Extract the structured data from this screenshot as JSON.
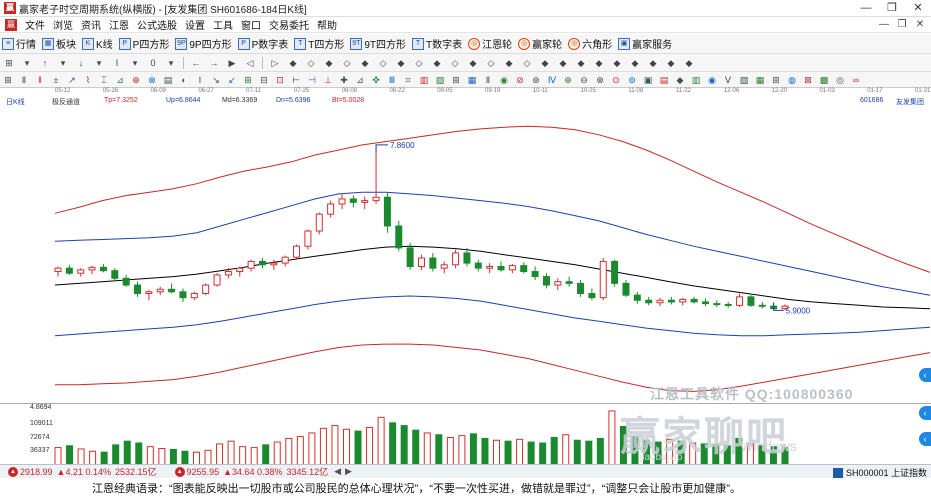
{
  "window": {
    "title": "赢家老子时空周期系统(纵横版) - [友发集团  SH601686-184日K线]",
    "app_icon": "赢",
    "controls": [
      "—",
      "❐",
      "✕"
    ]
  },
  "menu": {
    "icon": "赢",
    "items": [
      "文件",
      "浏览",
      "资讯",
      "江恩",
      "公式选股",
      "设置",
      "工具",
      "窗口",
      "交易委托",
      "帮助"
    ],
    "mdi_controls": [
      "—",
      "❐",
      "✕"
    ]
  },
  "toolbar1": {
    "items": [
      {
        "icon": "≡",
        "label": "行情"
      },
      {
        "icon": "▦",
        "label": "板块"
      },
      {
        "icon": "K",
        "label": "K线"
      },
      {
        "icon": "P",
        "label": "P四方形"
      },
      {
        "icon": "9P",
        "label": "9P四方形"
      },
      {
        "icon": "P",
        "label": "P数字表"
      },
      {
        "icon": "T",
        "label": "T四方形"
      },
      {
        "icon": "9T",
        "label": "9T四方形"
      },
      {
        "icon": "T",
        "label": "T数字表"
      },
      {
        "icon": "◎",
        "label": "江恩轮",
        "round": true
      },
      {
        "icon": "◎",
        "label": "赢家轮",
        "round": true
      },
      {
        "icon": "◎",
        "label": "六角形",
        "round": true
      },
      {
        "icon": "▣",
        "label": "赢家服务"
      }
    ]
  },
  "toolbar2": {
    "items": [
      "⊞",
      "▾",
      "↑",
      "▾",
      "↓",
      "▾",
      "Ι",
      "▾",
      "0",
      "▾",
      "←",
      "→",
      "▶",
      "◁",
      "▷",
      "◆",
      "◇",
      "◆",
      "◇",
      "◆",
      "◇",
      "◆",
      "◇",
      "◆",
      "◇",
      "◆",
      "◇",
      "◆",
      "◇",
      "◆",
      "◆",
      "◆",
      "◆",
      "◆",
      "◆",
      "◆",
      "◆",
      "◆"
    ]
  },
  "toolbar3": {
    "items": [
      "⊞",
      "Ⅱ",
      "‖",
      "±",
      "↗",
      "⌇",
      "⌶",
      "⊿",
      "⊕",
      "⊗",
      "▤",
      "◐",
      "Ⅰ",
      "↘",
      "↙",
      "⊞",
      "⊟",
      "⊡",
      "⊢",
      "⊣",
      "⊥",
      "✚",
      "⊿",
      "✜",
      "Ⅲ",
      "⌗",
      "▥",
      "▨",
      "⊞",
      "▦",
      "Ⅱ",
      "◉",
      "⊘",
      "⊛",
      "Ⅳ",
      "⊕",
      "⊖",
      "⊗",
      "⊙",
      "⊚",
      "▣",
      "▤",
      "◆",
      "▥",
      "◉",
      "Ⅴ",
      "▧",
      "▦",
      "⊞",
      "◍",
      "⊠",
      "▩",
      "◎",
      "∞"
    ]
  },
  "dates": [
    "05-12",
    "05-26",
    "06-09",
    "06-27",
    "07-11",
    "07-25",
    "08-08",
    "08-22",
    "09-05",
    "09-19",
    "10-11",
    "10-25",
    "11-08",
    "11-22",
    "12-06",
    "12-20",
    "01-03",
    "01-17",
    "01-31"
  ],
  "indicator": {
    "period_label": "日K线",
    "name": "极反通道",
    "tp": "Tp=7.3252",
    "up": "Up=6.8644",
    "md": "Md=6.3369",
    "dn": "Dn=5.6396",
    "bt": "Bt=5.0028",
    "code": "601686",
    "stock_name": "友发集团",
    "tp_color": "#c62828",
    "up_color": "#1e40af",
    "md_color": "#000000",
    "dn_color": "#1e40af",
    "bt_color": "#c62828"
  },
  "chart_data": {
    "type": "candlestick",
    "high_marker": "7.8600",
    "low_marker": "5.9000",
    "series": [
      {
        "name": "Tp",
        "color": "#c62828",
        "values": [
          7.05,
          7.12,
          7.2,
          7.26,
          7.3,
          7.34,
          7.4,
          7.48,
          7.55,
          7.6,
          7.66,
          7.74,
          7.8,
          7.86,
          7.9,
          7.94,
          7.98,
          8.02,
          8.05,
          8.07,
          8.08,
          8.07,
          8.04,
          7.98,
          7.9,
          7.8,
          7.68,
          7.55,
          7.42,
          7.3,
          7.18,
          7.05,
          6.92,
          6.8,
          6.68,
          6.56,
          6.45,
          6.35
        ]
      },
      {
        "name": "Up",
        "color": "#1e40af",
        "values": [
          6.72,
          6.73,
          6.74,
          6.75,
          6.76,
          6.78,
          6.82,
          6.9,
          6.98,
          7.06,
          7.14,
          7.22,
          7.28,
          7.3,
          7.3,
          7.28,
          7.26,
          7.23,
          7.2,
          7.17,
          7.13,
          7.08,
          7.02,
          6.96,
          6.88,
          6.8,
          6.73,
          6.66,
          6.6,
          6.54,
          6.48,
          6.42,
          6.36,
          6.3,
          6.24,
          6.18,
          6.13,
          6.08
        ]
      },
      {
        "name": "Md",
        "color": "#000000",
        "values": [
          6.2,
          6.22,
          6.24,
          6.26,
          6.28,
          6.3,
          6.33,
          6.37,
          6.41,
          6.46,
          6.5,
          6.54,
          6.58,
          6.62,
          6.65,
          6.66,
          6.65,
          6.63,
          6.6,
          6.56,
          6.52,
          6.48,
          6.44,
          6.39,
          6.34,
          6.29,
          6.24,
          6.19,
          6.15,
          6.11,
          6.07,
          6.03,
          6.0,
          5.98,
          5.96,
          5.94,
          5.93,
          5.92
        ]
      },
      {
        "name": "Dn",
        "color": "#1e40af",
        "values": [
          5.6,
          5.62,
          5.64,
          5.66,
          5.68,
          5.7,
          5.73,
          5.77,
          5.82,
          5.87,
          5.92,
          5.97,
          6.01,
          6.04,
          6.06,
          6.07,
          6.06,
          6.04,
          6.01,
          5.96,
          5.91,
          5.86,
          5.81,
          5.77,
          5.73,
          5.69,
          5.66,
          5.63,
          5.61,
          5.6,
          5.6,
          5.61,
          5.62,
          5.63,
          5.64,
          5.66,
          5.68,
          5.7
        ]
      },
      {
        "name": "Bt",
        "color": "#c62828",
        "values": [
          5.02,
          5.02,
          5.03,
          5.04,
          5.06,
          5.08,
          5.12,
          5.17,
          5.23,
          5.29,
          5.35,
          5.41,
          5.46,
          5.49,
          5.5,
          5.5,
          5.49,
          5.46,
          5.43,
          5.38,
          5.33,
          5.26,
          5.19,
          5.12,
          5.05,
          4.99,
          4.95,
          4.94,
          4.96,
          5.0,
          5.05,
          5.1,
          5.15,
          5.2,
          5.25,
          5.3,
          5.35,
          5.4
        ]
      }
    ],
    "candles": [
      {
        "o": 6.36,
        "h": 6.42,
        "l": 6.3,
        "c": 6.4
      },
      {
        "o": 6.4,
        "h": 6.44,
        "l": 6.32,
        "c": 6.34
      },
      {
        "o": 6.34,
        "h": 6.4,
        "l": 6.3,
        "c": 6.38
      },
      {
        "o": 6.38,
        "h": 6.43,
        "l": 6.33,
        "c": 6.41
      },
      {
        "o": 6.41,
        "h": 6.45,
        "l": 6.35,
        "c": 6.37
      },
      {
        "o": 6.37,
        "h": 6.4,
        "l": 6.25,
        "c": 6.28
      },
      {
        "o": 6.28,
        "h": 6.32,
        "l": 6.18,
        "c": 6.2
      },
      {
        "o": 6.2,
        "h": 6.24,
        "l": 6.06,
        "c": 6.1
      },
      {
        "o": 6.1,
        "h": 6.14,
        "l": 6.02,
        "c": 6.12
      },
      {
        "o": 6.12,
        "h": 6.18,
        "l": 6.08,
        "c": 6.15
      },
      {
        "o": 6.15,
        "h": 6.22,
        "l": 6.1,
        "c": 6.12
      },
      {
        "o": 6.12,
        "h": 6.16,
        "l": 6.0,
        "c": 6.05
      },
      {
        "o": 6.05,
        "h": 6.12,
        "l": 6.02,
        "c": 6.1
      },
      {
        "o": 6.1,
        "h": 6.22,
        "l": 6.08,
        "c": 6.2
      },
      {
        "o": 6.2,
        "h": 6.34,
        "l": 6.18,
        "c": 6.32
      },
      {
        "o": 6.32,
        "h": 6.4,
        "l": 6.28,
        "c": 6.36
      },
      {
        "o": 6.36,
        "h": 6.42,
        "l": 6.3,
        "c": 6.4
      },
      {
        "o": 6.4,
        "h": 6.5,
        "l": 6.36,
        "c": 6.48
      },
      {
        "o": 6.48,
        "h": 6.52,
        "l": 6.4,
        "c": 6.44
      },
      {
        "o": 6.44,
        "h": 6.5,
        "l": 6.38,
        "c": 6.46
      },
      {
        "o": 6.46,
        "h": 6.55,
        "l": 6.42,
        "c": 6.53
      },
      {
        "o": 6.53,
        "h": 6.68,
        "l": 6.5,
        "c": 6.66
      },
      {
        "o": 6.66,
        "h": 6.86,
        "l": 6.62,
        "c": 6.84
      },
      {
        "o": 6.84,
        "h": 7.06,
        "l": 6.8,
        "c": 7.04
      },
      {
        "o": 7.04,
        "h": 7.2,
        "l": 7.0,
        "c": 7.16
      },
      {
        "o": 7.16,
        "h": 7.28,
        "l": 7.1,
        "c": 7.22
      },
      {
        "o": 7.22,
        "h": 7.26,
        "l": 7.12,
        "c": 7.18
      },
      {
        "o": 7.18,
        "h": 7.25,
        "l": 7.1,
        "c": 7.2
      },
      {
        "o": 7.2,
        "h": 7.86,
        "l": 7.16,
        "c": 7.24
      },
      {
        "o": 7.24,
        "h": 7.3,
        "l": 6.82,
        "c": 6.9
      },
      {
        "o": 6.9,
        "h": 6.96,
        "l": 6.6,
        "c": 6.64
      },
      {
        "o": 6.64,
        "h": 6.7,
        "l": 6.38,
        "c": 6.42
      },
      {
        "o": 6.42,
        "h": 6.56,
        "l": 6.38,
        "c": 6.52
      },
      {
        "o": 6.52,
        "h": 6.58,
        "l": 6.36,
        "c": 6.4
      },
      {
        "o": 6.4,
        "h": 6.48,
        "l": 6.34,
        "c": 6.44
      },
      {
        "o": 6.44,
        "h": 6.62,
        "l": 6.4,
        "c": 6.58
      },
      {
        "o": 6.58,
        "h": 6.64,
        "l": 6.42,
        "c": 6.46
      },
      {
        "o": 6.46,
        "h": 6.5,
        "l": 6.36,
        "c": 6.4
      },
      {
        "o": 6.4,
        "h": 6.46,
        "l": 6.34,
        "c": 6.42
      },
      {
        "o": 6.42,
        "h": 6.48,
        "l": 6.36,
        "c": 6.38
      },
      {
        "o": 6.38,
        "h": 6.45,
        "l": 6.34,
        "c": 6.43
      },
      {
        "o": 6.43,
        "h": 6.47,
        "l": 6.34,
        "c": 6.36
      },
      {
        "o": 6.36,
        "h": 6.42,
        "l": 6.26,
        "c": 6.3
      },
      {
        "o": 6.3,
        "h": 6.34,
        "l": 6.16,
        "c": 6.2
      },
      {
        "o": 6.2,
        "h": 6.28,
        "l": 6.14,
        "c": 6.24
      },
      {
        "o": 6.24,
        "h": 6.3,
        "l": 6.18,
        "c": 6.22
      },
      {
        "o": 6.22,
        "h": 6.26,
        "l": 6.06,
        "c": 6.1
      },
      {
        "o": 6.1,
        "h": 6.16,
        "l": 6.02,
        "c": 6.05
      },
      {
        "o": 6.05,
        "h": 6.52,
        "l": 6.02,
        "c": 6.48
      },
      {
        "o": 6.48,
        "h": 6.5,
        "l": 6.18,
        "c": 6.22
      },
      {
        "o": 6.22,
        "h": 6.26,
        "l": 6.06,
        "c": 6.08
      },
      {
        "o": 6.08,
        "h": 6.12,
        "l": 5.98,
        "c": 6.02
      },
      {
        "o": 6.02,
        "h": 6.06,
        "l": 5.96,
        "c": 5.99
      },
      {
        "o": 5.99,
        "h": 6.05,
        "l": 5.95,
        "c": 6.02
      },
      {
        "o": 6.02,
        "h": 6.06,
        "l": 5.97,
        "c": 6.0
      },
      {
        "o": 6.0,
        "h": 6.05,
        "l": 5.96,
        "c": 6.03
      },
      {
        "o": 6.03,
        "h": 6.06,
        "l": 5.98,
        "c": 6.0
      },
      {
        "o": 6.0,
        "h": 6.04,
        "l": 5.95,
        "c": 5.98
      },
      {
        "o": 5.98,
        "h": 6.02,
        "l": 5.94,
        "c": 5.97
      },
      {
        "o": 5.97,
        "h": 6.0,
        "l": 5.93,
        "c": 5.96
      },
      {
        "o": 5.96,
        "h": 6.1,
        "l": 5.94,
        "c": 6.06
      },
      {
        "o": 6.06,
        "h": 6.08,
        "l": 5.94,
        "c": 5.96
      },
      {
        "o": 5.96,
        "h": 6.0,
        "l": 5.92,
        "c": 5.95
      },
      {
        "o": 5.95,
        "h": 5.98,
        "l": 5.9,
        "c": 5.92
      },
      {
        "o": 5.92,
        "h": 5.97,
        "l": 5.9,
        "c": 5.95
      }
    ],
    "volume_labels": [
      "4.8694",
      "109011",
      "72674",
      "36337"
    ],
    "volumes": [
      38,
      42,
      35,
      30,
      28,
      44,
      52,
      48,
      40,
      36,
      34,
      30,
      28,
      32,
      46,
      52,
      40,
      38,
      44,
      50,
      58,
      62,
      70,
      80,
      86,
      78,
      74,
      82,
      104,
      92,
      86,
      76,
      70,
      66,
      60,
      64,
      68,
      58,
      54,
      52,
      56,
      50,
      48,
      60,
      66,
      54,
      52,
      58,
      118,
      84,
      62,
      54,
      50,
      56,
      52,
      48,
      46,
      44,
      42,
      58,
      46,
      42,
      40,
      38
    ]
  },
  "volume_axis_labels": [
    "4.8694",
    "109011",
    "72674",
    "36337"
  ],
  "watermarks": {
    "line1": "江恩工具软件  QQ:100800360",
    "line2": "赢家聊吧",
    "line3": "jiaoba.vip",
    "windows": "Windows"
  },
  "statusbar": {
    "sh_value": "2918.99",
    "sh_change": "▲4.21 0.14%",
    "sh_amount": "2532.15亿",
    "sz_value": "9255.95",
    "sz_change": "▲34.64 0.38%",
    "sz_amount": "3345.12亿",
    "nav_prev": "◀",
    "nav_next": "▶",
    "index_label": "SH000001 上证指数"
  },
  "quote": "江恩经典语录：“图表能反映出一切股市或公司股民的总体心理状况”，“不要一次性买进，做错就是罪过”，“调整只会让股市更加健康”。"
}
